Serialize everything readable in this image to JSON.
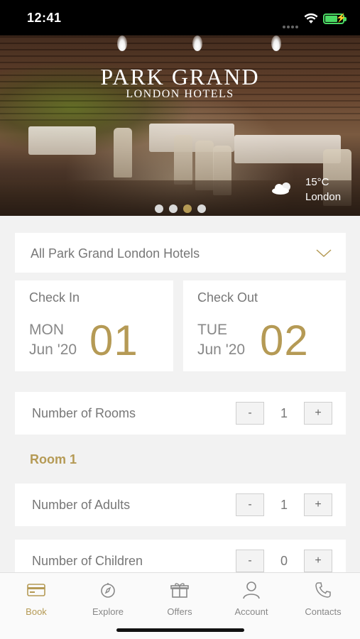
{
  "status_bar": {
    "time": "12:41"
  },
  "hero": {
    "brand_line1": "PARK GRAND",
    "brand_line2": "LONDON HOTELS",
    "weather": {
      "temperature": "15°C",
      "city": "London",
      "icon": "partly-cloudy-icon"
    },
    "carousel": {
      "total": 4,
      "active_index": 2
    }
  },
  "hotel_select": {
    "selected": "All Park Grand London Hotels"
  },
  "check_in": {
    "title": "Check In",
    "weekday": "MON",
    "month_year": "Jun '20",
    "day": "01"
  },
  "check_out": {
    "title": "Check Out",
    "weekday": "TUE",
    "month_year": "Jun '20",
    "day": "02"
  },
  "rooms": {
    "label": "Number of Rooms",
    "value": "1",
    "minus": "-",
    "plus": "+"
  },
  "room_heading": "Room 1",
  "adults": {
    "label": "Number of Adults",
    "value": "1",
    "minus": "-",
    "plus": "+"
  },
  "children": {
    "label": "Number of Children",
    "value": "0",
    "minus": "-",
    "plus": "+"
  },
  "tabs": [
    {
      "label": "Book",
      "icon": "credit-card-icon",
      "active": true
    },
    {
      "label": "Explore",
      "icon": "compass-icon",
      "active": false
    },
    {
      "label": "Offers",
      "icon": "gift-icon",
      "active": false
    },
    {
      "label": "Account",
      "icon": "user-icon",
      "active": false
    },
    {
      "label": "Contacts",
      "icon": "phone-icon",
      "active": false
    }
  ],
  "colors": {
    "accent": "#b59a55",
    "background": "#f2f2f2",
    "card": "#ffffff",
    "text": "#777777"
  }
}
